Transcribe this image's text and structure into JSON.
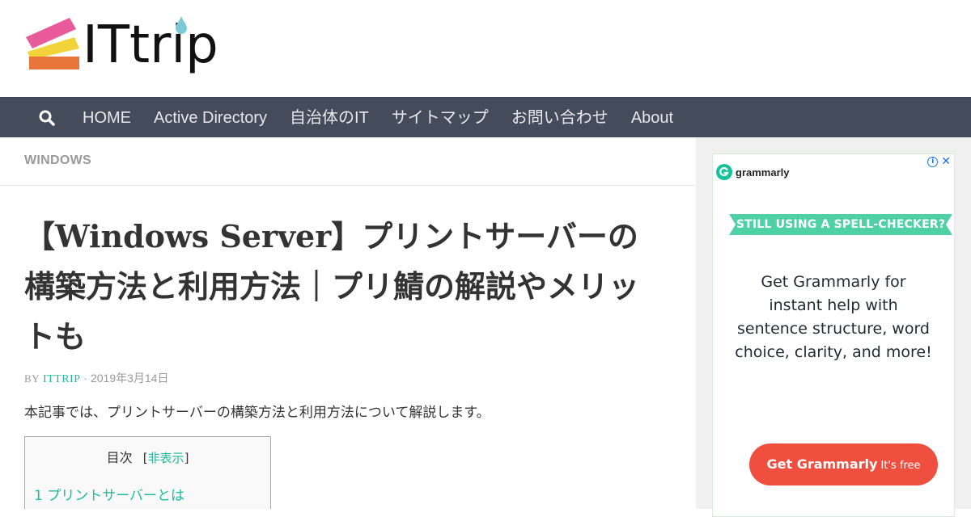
{
  "site": {
    "logo_text": "ITtrip"
  },
  "nav": {
    "search_icon": "search-icon",
    "items": [
      "HOME",
      "Active Directory",
      "自治体のIT",
      "サイトマップ",
      "お問い合わせ",
      "About"
    ]
  },
  "article": {
    "category": "WINDOWS",
    "title": "【Windows Server】プリントサーバーの構築方法と利用方法｜プリ鯖の解説やメリットも",
    "byline_by": "BY",
    "author": "ITTRIP",
    "separator": "·",
    "date": "2019年3月14日",
    "intro": "本記事では、プリントサーバーの構築方法と利用方法について解説します。"
  },
  "toc": {
    "title": "目次",
    "toggle_open": "[",
    "toggle_label": "非表示",
    "toggle_close": "]",
    "first_item": "1  プリントサーバーとは"
  },
  "ad": {
    "brand": "grammarly",
    "banner": "STILL USING A SPELL-CHECKER?",
    "body_lines": [
      "Get Grammarly for",
      "instant help with",
      "sentence structure, word",
      "choice, clarity, and more!"
    ],
    "cta_main": "Get Grammarly",
    "cta_sub": "It's free",
    "info_symbol": "i",
    "close_symbol": "✕"
  },
  "colors": {
    "nav_bg": "#444c5c",
    "accent": "#1abc9c",
    "ad_green": "#15c39a",
    "ad_cta": "#f04e3e"
  }
}
